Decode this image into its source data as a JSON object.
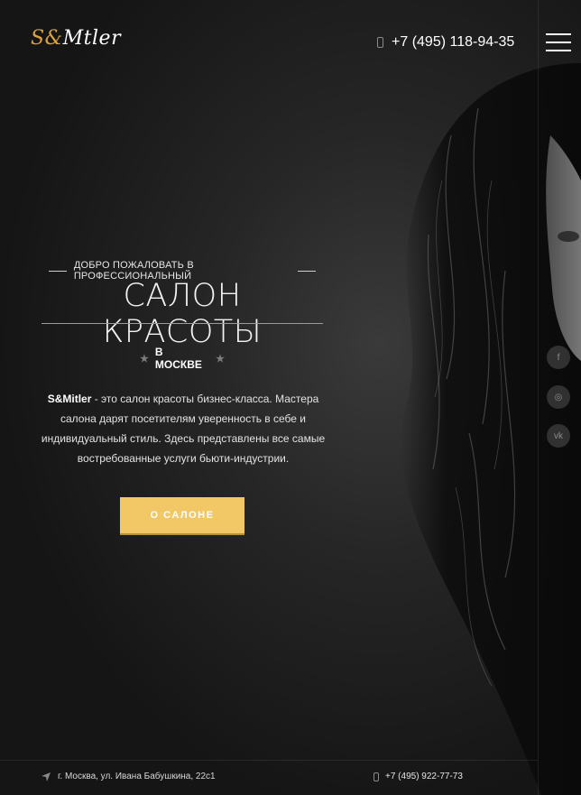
{
  "header": {
    "logo_left": "S&",
    "logo_right": "Mtler",
    "phone": "+7 (495) 118-94-35"
  },
  "hero": {
    "kicker": "ДОБРО ПОЖАЛОВАТЬ В ПРОФЕССИОНАЛЬНЫЙ",
    "title": "САЛОН КРАСОТЫ",
    "city": "В МОСКВЕ",
    "brand": "S&Mitler",
    "desc_rest": " - это салон красоты бизнес-класса. Мастера салона дарят посетителям уверенность в себе и индивидуальный стиль. Здесь представлены все самые востребованные услуги бьюти-индустрии.",
    "button": "О САЛОНЕ"
  },
  "social": {
    "facebook": "f",
    "instagram": "◎",
    "vk": "vk"
  },
  "footer": {
    "address": "г. Москва, ул. Ивана Бабушкина, 22с1",
    "phone": "+7 (495) 922-77-73"
  },
  "colors": {
    "accent": "#f2c765",
    "logo_accent": "#d9a23e"
  },
  "icons": [
    "phone-icon",
    "menu-icon",
    "star-icon",
    "facebook-icon",
    "instagram-icon",
    "vk-icon",
    "location-icon"
  ]
}
